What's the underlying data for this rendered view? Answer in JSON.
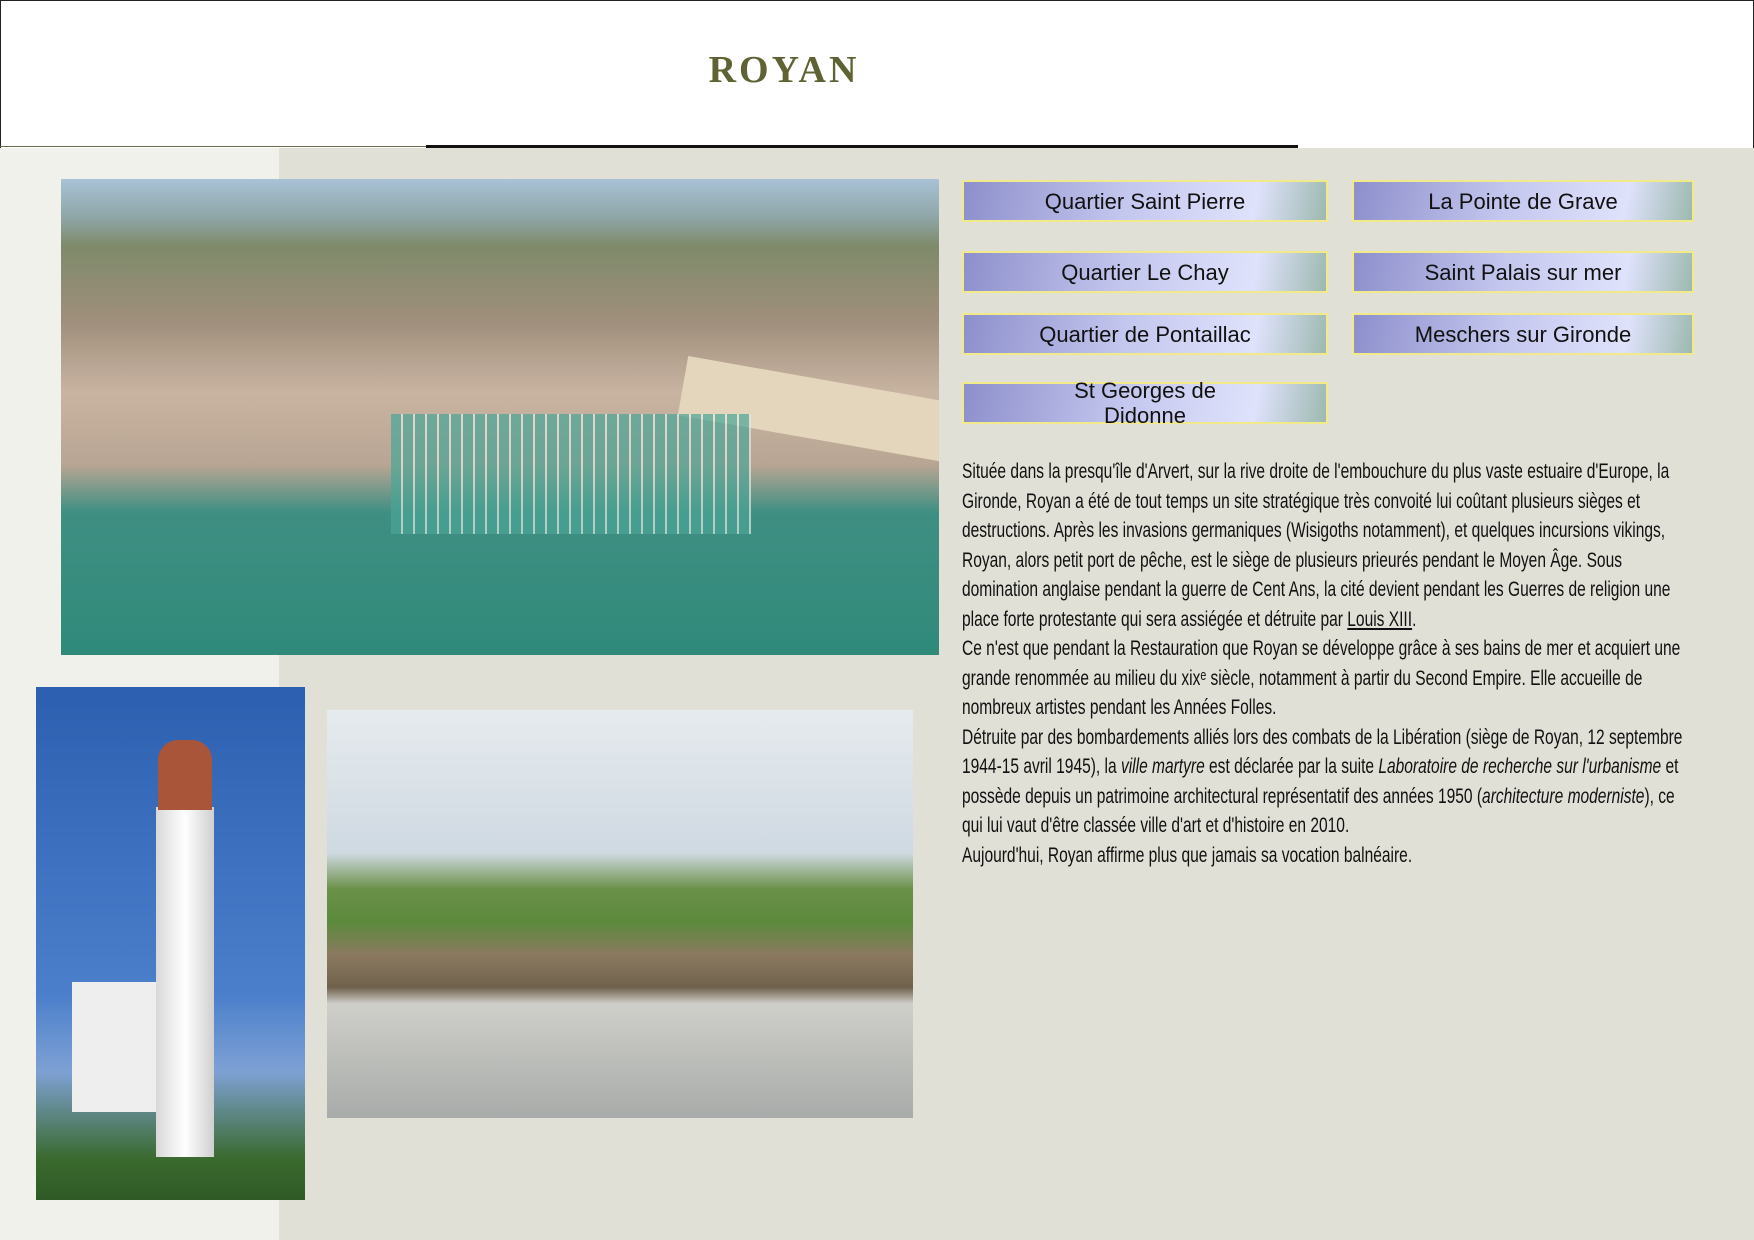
{
  "title": "ROYAN",
  "buttons": [
    "Quartier Saint Pierre",
    "La Pointe de Grave",
    "Quartier Le Chay",
    "Saint Palais sur mer",
    "Quartier de Pontaillac",
    "Meschers sur Gironde",
    "St Georges de Didonne"
  ],
  "text": {
    "p1a": "Située dans la presqu'île d'Arvert, sur la rive droite de l'embouchure du plus vaste estuaire d'Europe, la Gironde, Royan a été de tout temps un site stratégique très convoité lui coûtant plusieurs sièges et destructions. Après les invasions germaniques (Wisigoths notamment), et quelques incursions vikings, Royan, alors petit port de pêche, est le siège de plusieurs prieurés pendant le Moyen Âge. Sous domination anglaise pendant la guerre de Cent Ans, la cité devient pendant les Guerres de religion une place forte protestante qui sera assiégée et détruite par ",
    "p1link": "Louis XIII",
    "p1b": ".",
    "p2": "Ce n'est que pendant la Restauration que Royan se développe grâce à ses bains de mer et acquiert une grande renommée au milieu du xixᵉ siècle, notamment à partir du Second Empire. Elle accueille de nombreux artistes pendant les Années Folles.",
    "p3a": "Détruite par des bombardements alliés lors des combats de la Libération (siège de Royan, 12 septembre 1944-15 avril 1945), la ",
    "p3i1": "ville martyre",
    "p3b": " est déclarée par la suite ",
    "p3i2": "Laboratoire de recherche sur l'urbanisme",
    "p3c": " et possède depuis un patrimoine architectural représentatif des années 1950 (",
    "p3i3": "architecture moderniste",
    "p3d": "), ce qui lui vaut d'être classée ville d'art et d'histoire en 2010.",
    "p4": "Aujourd'hui, Royan affirme plus que jamais sa vocation balnéaire."
  }
}
